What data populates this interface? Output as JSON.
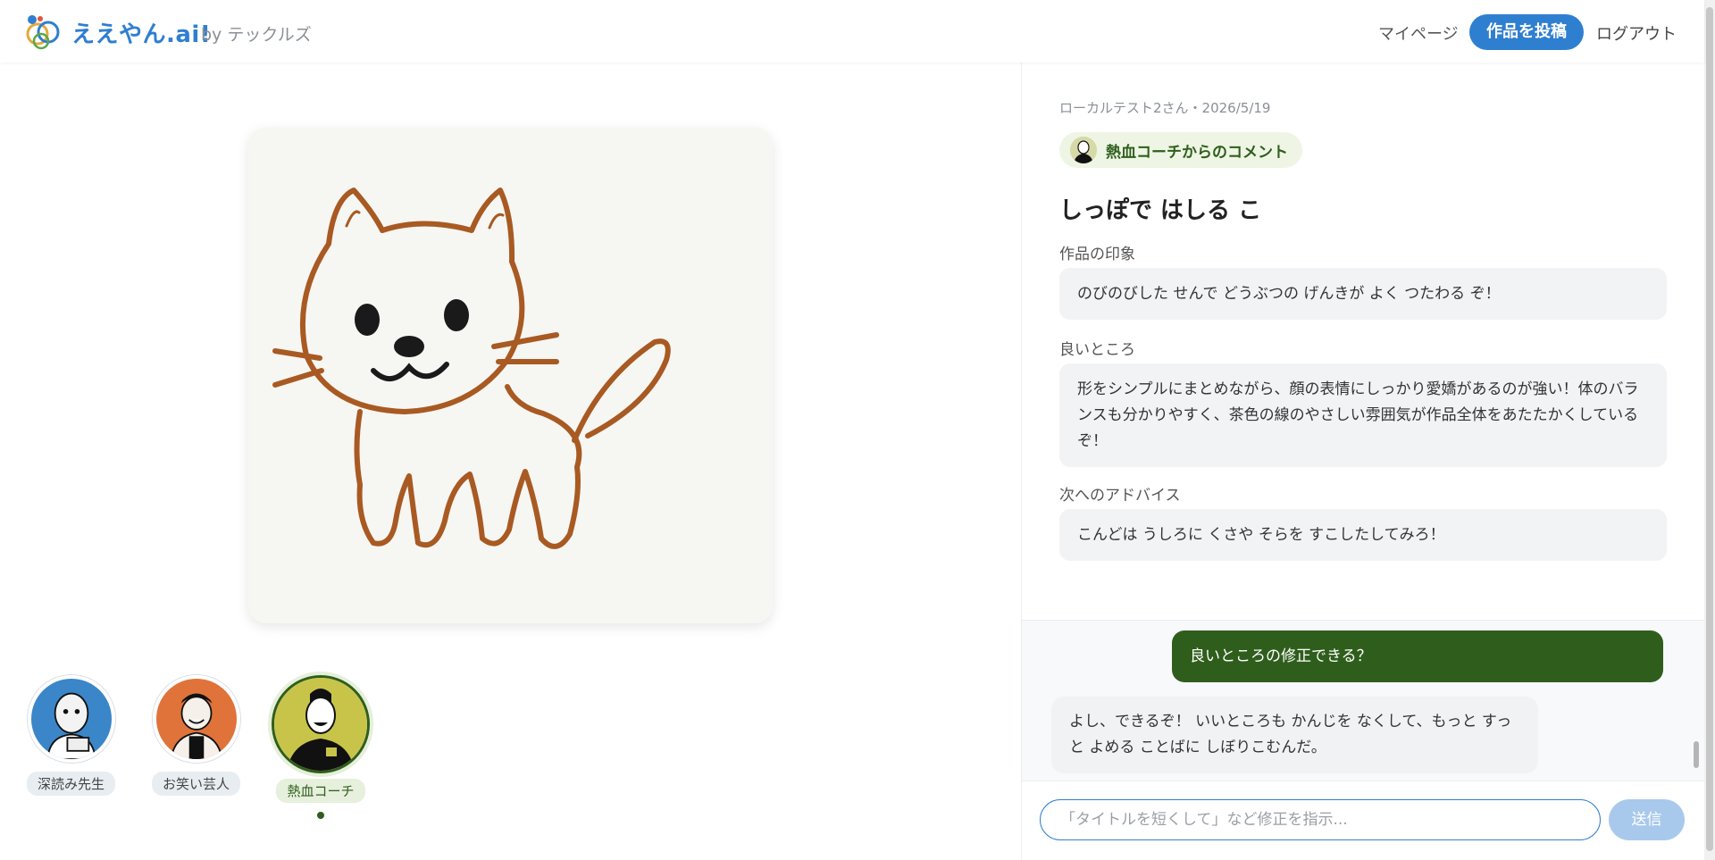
{
  "header": {
    "brand": "ええやん.ai!",
    "by": "by テックルズ",
    "nav": {
      "mypage": "マイページ",
      "post": "作品を投稿",
      "logout": "ログアウト"
    }
  },
  "artwork": {
    "icon": "cat-drawing"
  },
  "characters": [
    {
      "label": "深読み先生",
      "active": false,
      "color": "#3a86c9"
    },
    {
      "label": "お笑い芸人",
      "active": false,
      "color": "#e0733a"
    },
    {
      "label": "熱血コーチ",
      "active": true,
      "color": "#c8c44a"
    }
  ],
  "panel": {
    "meta": "ローカルテスト2さん・2026/5/19",
    "chip": "熱血コーチからのコメント",
    "title": "しっぽで はしる こ",
    "sections": [
      {
        "label": "作品の印象",
        "text": "のびのびした せんで どうぶつの げんきが よく つたわる ぞ！"
      },
      {
        "label": "良いところ",
        "text": "形をシンプルにまとめながら、顔の表情にしっかり愛嬌があるのが強い！体のバランスも分かりやすく、茶色の線のやさしい雰囲気が作品全体をあたたかくしているぞ！"
      },
      {
        "label": "次へのアドバイス",
        "text": "こんどは うしろに くさや そらを すこしたしてみろ！"
      }
    ]
  },
  "chat": {
    "user_message": "良いところの修正できる？",
    "bot_message": "よし、できるぞ！ いいところも かんじを なくして、もっと すっと よめる ことばに しぼりこむんだ。",
    "input_placeholder": "「タイトルを短くして」など修正を指示...",
    "send_label": "送信"
  },
  "colors": {
    "accent": "#2f7fd0",
    "coach_green": "#2f5e1c"
  }
}
